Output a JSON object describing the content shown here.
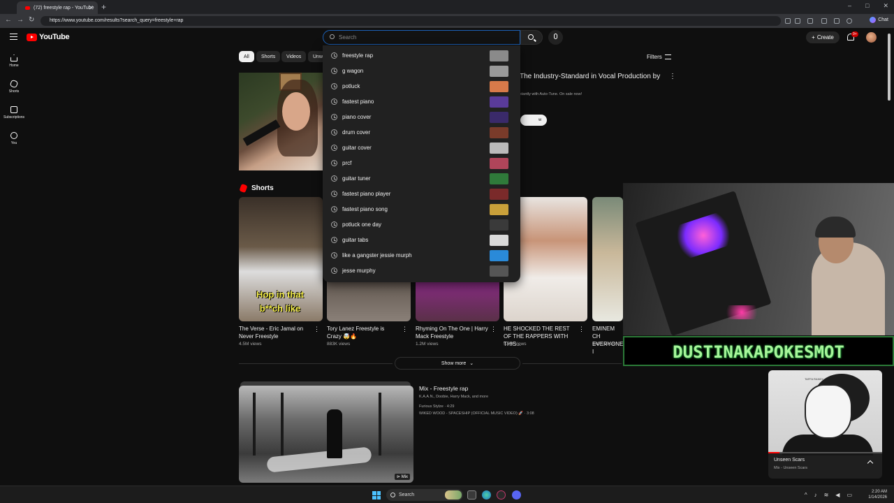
{
  "browser": {
    "tab_title": "(72) freestyle rap - YouTube",
    "url": "https://www.youtube.com/results?search_query=freestyle+rap",
    "chat_label": "Chat"
  },
  "header": {
    "logo_text": "YouTube",
    "search_placeholder": "Search",
    "create_label": "Create",
    "notification_count": "9+"
  },
  "rail": [
    {
      "label": "Home",
      "icon": "home-icon"
    },
    {
      "label": "Shorts",
      "icon": "shorts-icon"
    },
    {
      "label": "Subscriptions",
      "icon": "subscriptions-icon"
    },
    {
      "label": "You",
      "icon": "you-icon"
    }
  ],
  "chips": [
    "All",
    "Shorts",
    "Videos",
    "Unw"
  ],
  "filters_label": "Filters",
  "ad": {
    "title": "The Industry-Standard in Vocal Production by",
    "subtitle": "stantly with Auto-Tune. On sale now!",
    "button_label": "w"
  },
  "suggestions": [
    {
      "text": "freestyle rap",
      "color": "#8a8a8a"
    },
    {
      "text": "g wagon",
      "color": "#9a9a9a"
    },
    {
      "text": "potluck",
      "color": "#d87a4a"
    },
    {
      "text": "fastest piano",
      "color": "#5a3b9a"
    },
    {
      "text": "piano cover",
      "color": "#3a2a6a"
    },
    {
      "text": "drum cover",
      "color": "#7a3b2a"
    },
    {
      "text": "guitar cover",
      "color": "#bbbbbb"
    },
    {
      "text": "prcf",
      "color": "#b0455a"
    },
    {
      "text": "guitar tuner",
      "color": "#2f7a3a"
    },
    {
      "text": "fastest piano player",
      "color": "#7a2a2a"
    },
    {
      "text": "fastest piano song",
      "color": "#c9a03a"
    },
    {
      "text": "potluck one day",
      "color": "#3a3a3a"
    },
    {
      "text": "guitar tabs",
      "color": "#d9d9d9"
    },
    {
      "text": "like a gangster jessie murph",
      "color": "#2a8ad9"
    },
    {
      "text": "jesse murphy",
      "color": "#555555"
    }
  ],
  "shorts": {
    "heading": "Shorts",
    "items": [
      {
        "title": "The Verse - Eric Jamal on Never Freestyle",
        "views": "4.5M views",
        "overlay": "Hop in that b**ch like",
        "bg": "#6a5a48"
      },
      {
        "title": "Tory Lanez Freestyle is Crazy 🤯🔥",
        "views": "883K views",
        "overlay": "",
        "bg": "#4a4038"
      },
      {
        "title": "Rhyming On The One | Harry Mack Freestyle",
        "views": "1.2M views",
        "overlay": "",
        "bg": "#7a2a7a"
      },
      {
        "title": "HE SHOCKED THE REST OF THE RAPPERS WITH THIS...",
        "views": "5.2M views",
        "overlay": "",
        "bg": "#d8d0c8"
      },
      {
        "title": "EMINEM CH EVERYONE I",
        "views": "640K views",
        "overlay": "",
        "bg": "#8a9a8a"
      }
    ],
    "show_more": "Show more"
  },
  "mix": {
    "badge": "Mix",
    "title": "Mix - Freestyle rap",
    "artists": "K.A.A.N., Doobie, Harry Mack, and more",
    "line1": "Furious Stylze · 4:29",
    "line2": "WIKED WOOD - SPACESHIP (OFFICIAL MUSIC VIDEO) 🚀 · 3:08"
  },
  "stream": {
    "name": "DUSTINAKAPOKESMOT"
  },
  "mini_player": {
    "title": "Unseen Scars",
    "subtitle": "Mix - Unseen Scars",
    "art_text": "TAFFA RANDY",
    "progress": 0.1
  },
  "taskbar": {
    "search_label": "Search",
    "time": "2:20 AM",
    "date": "1/14/2026"
  },
  "colors": {
    "accent_red": "#ff0000",
    "background": "#0f0f0f",
    "stream_green": "#a6f59a"
  }
}
